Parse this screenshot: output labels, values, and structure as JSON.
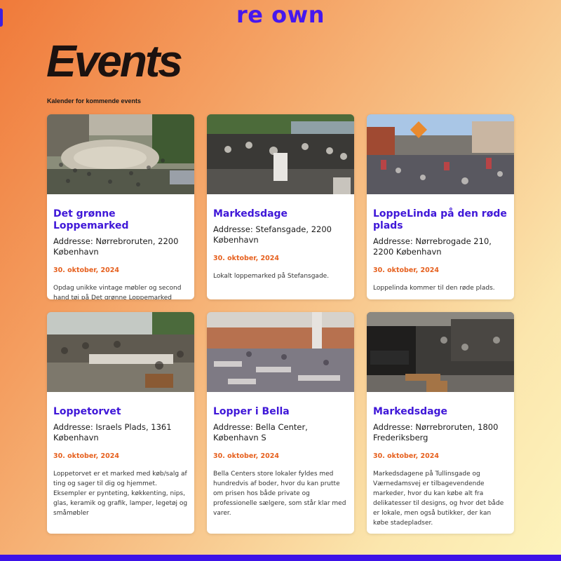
{
  "header": {
    "logo_text": "re own"
  },
  "page": {
    "title": "Events",
    "subtitle": "Kalender for kommende events"
  },
  "events": [
    {
      "title": "Det grønne Loppemarked",
      "address": "Addresse: Nørrebroruten, 2200 København",
      "date": "30. oktober, 2024",
      "description": "Opdag unikke vintage møbler og second hand tøj på Det grønne Loppemarked"
    },
    {
      "title": "Markedsdage",
      "address": "Addresse: Stefansgade, 2200 København",
      "date": "30. oktober, 2024",
      "description": "Lokalt loppemarked på Stefansgade."
    },
    {
      "title": "LoppeLinda på den røde plads",
      "address": "Addresse: Nørrebrogade 210, 2200 København",
      "date": "30. oktober, 2024",
      "description": "Loppelinda kommer til den røde plads."
    },
    {
      "title": "Loppetorvet",
      "address": "Addresse: Israels Plads, 1361 København",
      "date": "30. oktober, 2024",
      "description": "Loppetorvet er et marked med køb/salg af ting og sager til dig og hjemmet. Eksempler er pynteting, køkkenting, nips, glas, keramik og grafik, lamper, legetøj og småmøbler"
    },
    {
      "title": "Lopper i Bella",
      "address": "Addresse: Bella Center, København S",
      "date": "30. oktober, 2024",
      "description": "Bella Centers store lokaler fyldes med hundredvis af boder, hvor du kan prutte om prisen hos både private og professionelle sælgere, som står klar med varer."
    },
    {
      "title": "Markedsdage",
      "address": "Addresse: Nørrebroruten, 1800 Frederiksberg",
      "date": "30. oktober, 2024",
      "description": "Markedsdagene på Tullinsgade og Værnedamsvej er tilbagevendende markeder, hvor du kan købe alt fra delikatesser til designs, og hvor det både er lokale, men også butikker, der kan købe stadepladser."
    }
  ],
  "colors": {
    "brand": "#4617ee",
    "date_accent": "#e6601e",
    "footer_bar": "#3d12e8"
  }
}
